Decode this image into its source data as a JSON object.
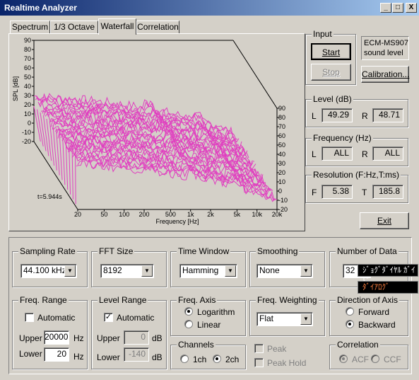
{
  "window": {
    "title": "Realtime Analyzer"
  },
  "titlebar_buttons": {
    "minimize": "_",
    "maximize": "□",
    "close": "X"
  },
  "tabs": [
    "Spectrum",
    "1/3 Octave",
    "Waterfall",
    "Correlation"
  ],
  "chart": {
    "ylabel": "SPL [dB]",
    "xlabel": "Frequency  [Hz]",
    "left_ticks": [
      "90",
      "80",
      "70",
      "60",
      "50",
      "40",
      "30",
      "20",
      "10",
      "0",
      "-10",
      "-20"
    ],
    "right_ticks": [
      "90",
      "80",
      "70",
      "60",
      "50",
      "40",
      "30",
      "20",
      "10",
      "0",
      "-10",
      "-20"
    ],
    "x_ticks": [
      "20",
      "50",
      "100",
      "200",
      "500",
      "1k",
      "2k",
      "5k",
      "10k",
      "20k"
    ],
    "time_label": "t=5.944s",
    "line_color": "#e040c0"
  },
  "input": {
    "label": "Input",
    "start": "Start",
    "stop": "Stop",
    "device": "ECM-MS907\nsound level",
    "calibration": "Calibration..."
  },
  "level": {
    "label": "Level (dB)",
    "L_label": "L",
    "L_value": "49.29",
    "R_label": "R",
    "R_value": "48.71"
  },
  "frequency": {
    "label": "Frequency (Hz)",
    "L_label": "L",
    "L_value": "ALL",
    "R_label": "R",
    "R_value": "ALL"
  },
  "resolution": {
    "label": "Resolution (F:Hz,T:ms)",
    "F_label": "F",
    "F_value": "5.38",
    "T_label": "T",
    "T_value": "185.8"
  },
  "exit": "Exit",
  "sampling_rate": {
    "label": "Sampling Rate",
    "value": "44.100 kHz"
  },
  "fft_size": {
    "label": "FFT Size",
    "value": "8192"
  },
  "time_window": {
    "label": "Time Window",
    "value": "Hamming"
  },
  "smoothing": {
    "label": "Smoothing",
    "value": "None"
  },
  "number_of_data": {
    "label": "Number of Data",
    "value": "32"
  },
  "ime_popup": {
    "line1": "ｼﾞｮｸﾞﾀﾞｲﾔﾙ ｶﾞｲﾄﾞ",
    "line2": "ﾀﾞｲｱﾛｸﾞ"
  },
  "freq_range": {
    "label": "Freq. Range",
    "automatic": "Automatic",
    "automatic_checked": false,
    "upper_label": "Upper",
    "upper_value": "20000",
    "upper_unit": "Hz",
    "lower_label": "Lower",
    "lower_value": "20",
    "lower_unit": "Hz"
  },
  "level_range": {
    "label": "Level Range",
    "automatic": "Automatic",
    "automatic_checked": true,
    "upper_label": "Upper",
    "upper_value": "0",
    "upper_unit": "dB",
    "lower_label": "Lower",
    "lower_value": "-140",
    "lower_unit": "dB"
  },
  "freq_axis": {
    "label": "Freq. Axis",
    "options": [
      "Logarithm",
      "Linear"
    ],
    "selected": "Logarithm"
  },
  "channels": {
    "label": "Channels",
    "options": [
      "1ch",
      "2ch"
    ],
    "selected": "2ch"
  },
  "freq_weighting": {
    "label": "Freq. Weighting",
    "value": "Flat"
  },
  "peak": {
    "label": "Peak",
    "checked": false
  },
  "peak_hold": {
    "label": "Peak Hold",
    "checked": false
  },
  "direction": {
    "label": "Direction of Axis",
    "options": [
      "Forward",
      "Backward"
    ],
    "selected": "Backward"
  },
  "correlation": {
    "label": "Correlation",
    "options": [
      "ACF",
      "CCF"
    ],
    "selected": "ACF"
  }
}
